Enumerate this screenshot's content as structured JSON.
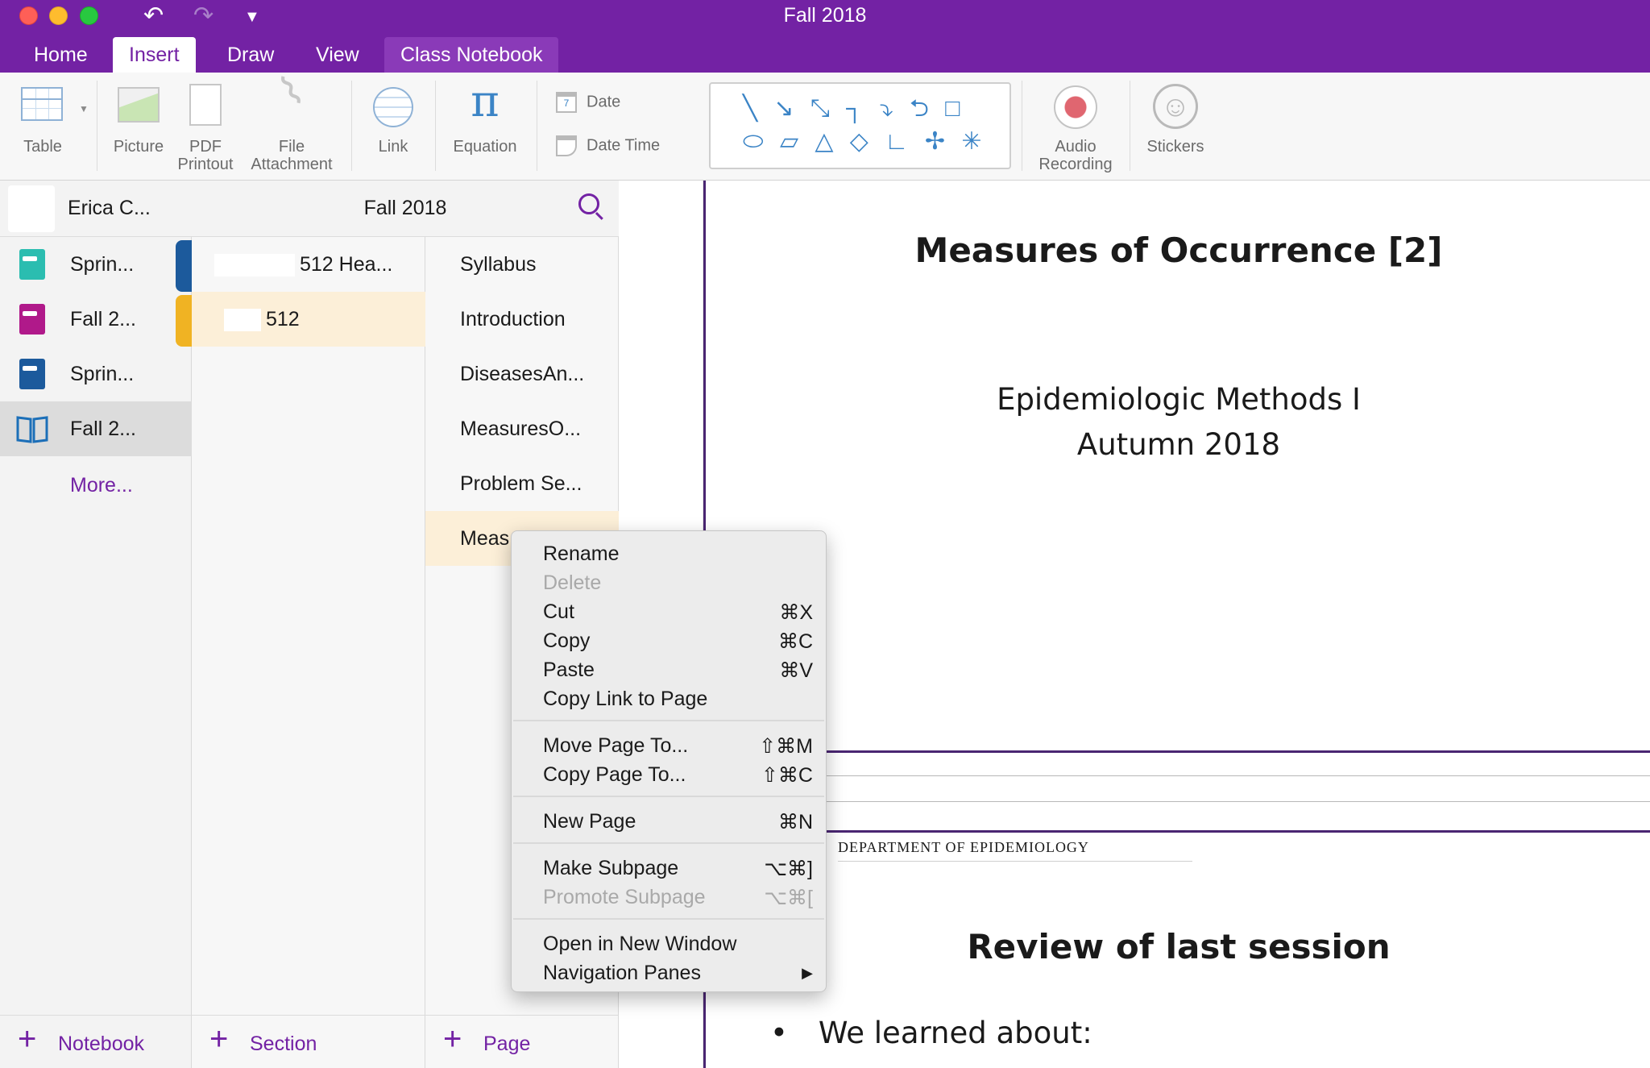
{
  "window": {
    "title": "Fall 2018",
    "undo_glyph": "↶",
    "redo_glyph": "↷",
    "qat_glyph": "▼"
  },
  "tabs": [
    {
      "label": "Home"
    },
    {
      "label": "Insert",
      "active": true
    },
    {
      "label": "Draw"
    },
    {
      "label": "View"
    },
    {
      "label": "Class Notebook"
    }
  ],
  "ribbon": {
    "table": "Table",
    "picture": "Picture",
    "pdf_line1": "PDF",
    "pdf_line2": "Printout",
    "file_line1": "File",
    "file_line2": "Attachment",
    "link": "Link",
    "equation": "Equation",
    "equation_glyph": "π",
    "date": "Date",
    "date_time": "Date  Time",
    "calendar_day": "7",
    "shapes_row1": "╲ ↘ ⤡ ┐ ⤵ ⮌ □",
    "shapes_row2": "⬭ ▱ △ ◇ ∟ ✢ ✳",
    "audio_line1": "Audio",
    "audio_line2": "Recording",
    "stickers": "Stickers",
    "sticker_glyph": "☺"
  },
  "account": {
    "name": "Erica C..."
  },
  "notebooks": [
    {
      "label": "Sprin...",
      "color": "#2bbdb0",
      "tab_color": "#1c5a9c"
    },
    {
      "label": "Fall 2...",
      "color": "#b0198a",
      "tab_color": "#f0b323"
    },
    {
      "label": "Sprin...",
      "color": "#1c5a9c",
      "tab_color": ""
    },
    {
      "label": "Fall 2...",
      "color": "#1c6fb8",
      "tab_color": "",
      "selected": true
    }
  ],
  "notebook_more": "More...",
  "add_notebook": "Notebook",
  "notebook_title": "Fall 2018",
  "sections": [
    {
      "label": "512 Hea..."
    },
    {
      "label": "512",
      "selected": true
    }
  ],
  "add_section": "Section",
  "pages": [
    {
      "label": "Syllabus"
    },
    {
      "label": "Introduction"
    },
    {
      "label": "DiseasesAn..."
    },
    {
      "label": "MeasuresO..."
    },
    {
      "label": "Problem Se..."
    },
    {
      "label": "Meas",
      "selected": true
    }
  ],
  "add_page": "Page",
  "add_glyph": "+",
  "canvas": {
    "title": "Measures of Occurrence [2]",
    "subtitle1": "Epidemiologic Methods I",
    "subtitle2": "Autumn 2018",
    "department": "DEPARTMENT OF EPIDEMIOLOGY",
    "slide2_title": "Review of last session",
    "bullet_glyph": "•",
    "bullet1": "We learned about:"
  },
  "context_menu": {
    "items": [
      {
        "label": "Rename",
        "shortcut": ""
      },
      {
        "label": "Delete",
        "shortcut": "",
        "disabled": true
      },
      {
        "label": "Cut",
        "shortcut": "⌘X"
      },
      {
        "label": "Copy",
        "shortcut": "⌘C"
      },
      {
        "label": "Paste",
        "shortcut": "⌘V"
      },
      {
        "label": "Copy Link to Page",
        "shortcut": ""
      },
      {
        "label": "Move Page To...",
        "shortcut": "⇧⌘M"
      },
      {
        "label": "Copy Page To...",
        "shortcut": "⇧⌘C"
      },
      {
        "label": "New Page",
        "shortcut": "⌘N"
      },
      {
        "label": "Make Subpage",
        "shortcut": "⌥⌘]"
      },
      {
        "label": "Promote Subpage",
        "shortcut": "⌥⌘[",
        "disabled": true
      },
      {
        "label": "Open in New Window",
        "shortcut": ""
      },
      {
        "label": "Navigation Panes",
        "shortcut": "▶"
      }
    ]
  },
  "colors": {
    "accent": "#7322a4",
    "selected_section": "#fcefd8",
    "page_rule": "#4a2672"
  }
}
